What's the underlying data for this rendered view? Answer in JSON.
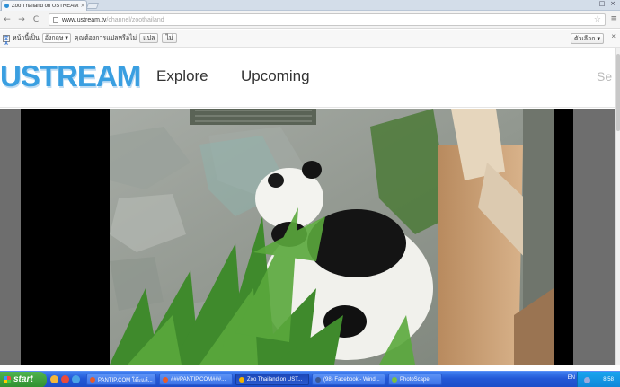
{
  "browser": {
    "tab_title": "Zoo Thailand on USTREAM: T",
    "tab_close": "×",
    "window_controls": [
      "–",
      "□",
      "×"
    ],
    "url_host": "www.ustream.tv",
    "url_path": "/channel/zoothailand",
    "back_glyph": "←",
    "forward_glyph": "→",
    "reload_glyph": "C",
    "star_glyph": "☆",
    "menu_glyph": "≡"
  },
  "translate_bar": {
    "icon_text": "文A",
    "prefix": "หน้านี้เป็น",
    "language": "อังกฤษ ▾",
    "question": "คุณต้องการแปลหรือไม่",
    "translate_button": "แปล",
    "no_button": "ไม่",
    "options_button": "ตัวเลือก ▾",
    "close": "×"
  },
  "site": {
    "logo": "USTREAM",
    "nav": [
      "Explore",
      "Upcoming"
    ],
    "search_hint": "Se"
  },
  "taskbar": {
    "start_label": "start",
    "tasks": [
      {
        "label": "PANTIP.COM โต๊ะแล้...",
        "active": false,
        "color": "#e85b2a"
      },
      {
        "label": "###PANTIP.COM###...",
        "active": false,
        "color": "#e85b2a"
      },
      {
        "label": "Zoo Thailand on UST...",
        "active": true,
        "color": "#f2b400"
      },
      {
        "label": "(98) Facebook - Wind...",
        "active": false,
        "color": "#3b5998"
      },
      {
        "label": "PhotoScape",
        "active": false,
        "color": "#7bc043"
      }
    ],
    "language": "EN",
    "clock": "8:58",
    "colors": {
      "start": "#3c9a3c",
      "bar": "#2358d6",
      "tray": "#0f86d8"
    }
  }
}
